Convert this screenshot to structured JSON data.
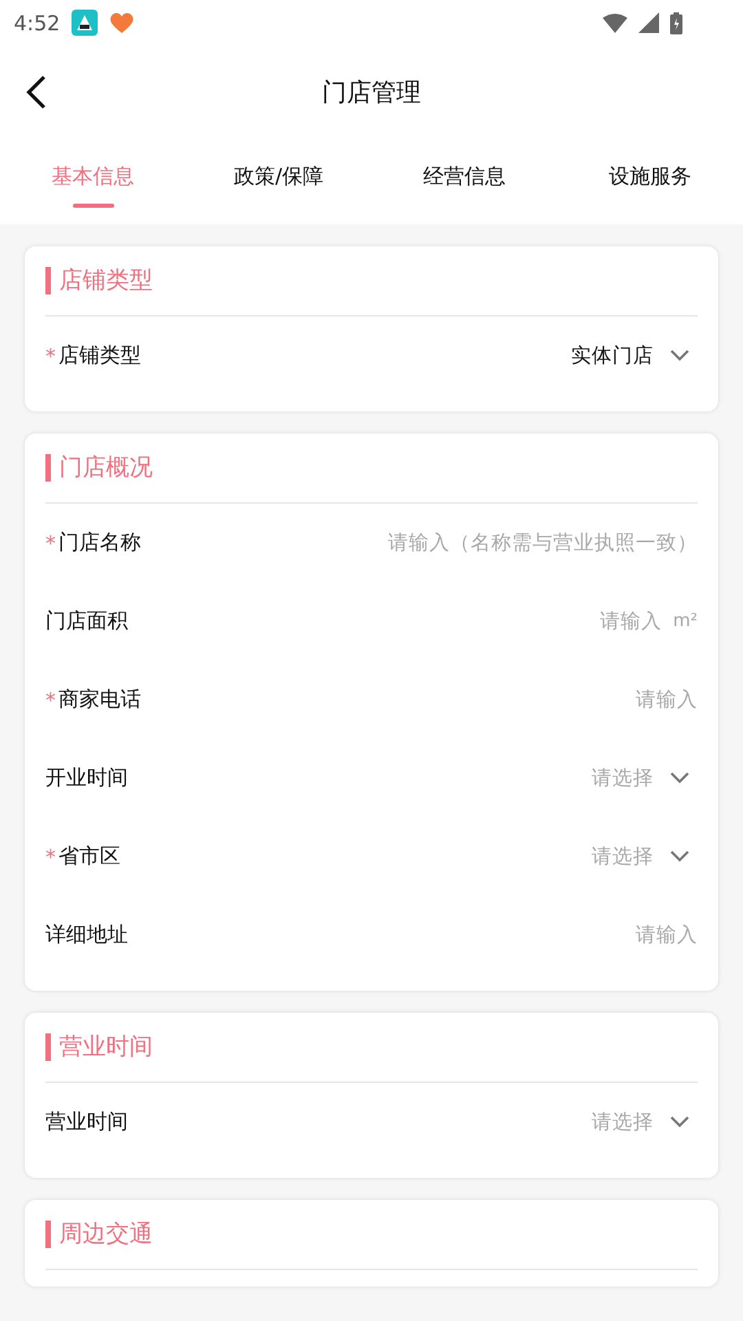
{
  "status_bar": {
    "time": "4:52"
  },
  "header": {
    "title": "门店管理"
  },
  "tabs": [
    {
      "label": "基本信息",
      "selected": true
    },
    {
      "label": "政策/保障",
      "selected": false
    },
    {
      "label": "经营信息",
      "selected": false
    },
    {
      "label": "设施服务",
      "selected": false
    }
  ],
  "sections": [
    {
      "title": "店铺类型",
      "rows": [
        {
          "kind": "select",
          "label": "店铺类型",
          "required_mark": "*",
          "value": "实体门店"
        }
      ]
    },
    {
      "title": "门店概况",
      "rows": [
        {
          "kind": "input",
          "label": "门店名称",
          "required_mark": "*",
          "placeholder": "请输入（名称需与营业执照一致）"
        },
        {
          "kind": "input",
          "label": "门店面积",
          "placeholder": "请输入",
          "unit": "m²"
        },
        {
          "kind": "input",
          "label": "商家电话",
          "required_mark": "*",
          "placeholder": "请输入"
        },
        {
          "kind": "select",
          "label": "开业时间",
          "placeholder": "请选择"
        },
        {
          "kind": "select",
          "label": "省市区",
          "required_mark": "*",
          "placeholder": "请选择"
        },
        {
          "kind": "input",
          "label": "详细地址",
          "placeholder": "请输入"
        }
      ]
    },
    {
      "title": "营业时间",
      "rows": [
        {
          "kind": "select",
          "label": "营业时间",
          "placeholder": "请选择"
        }
      ]
    },
    {
      "title": "周边交通"
    }
  ]
}
